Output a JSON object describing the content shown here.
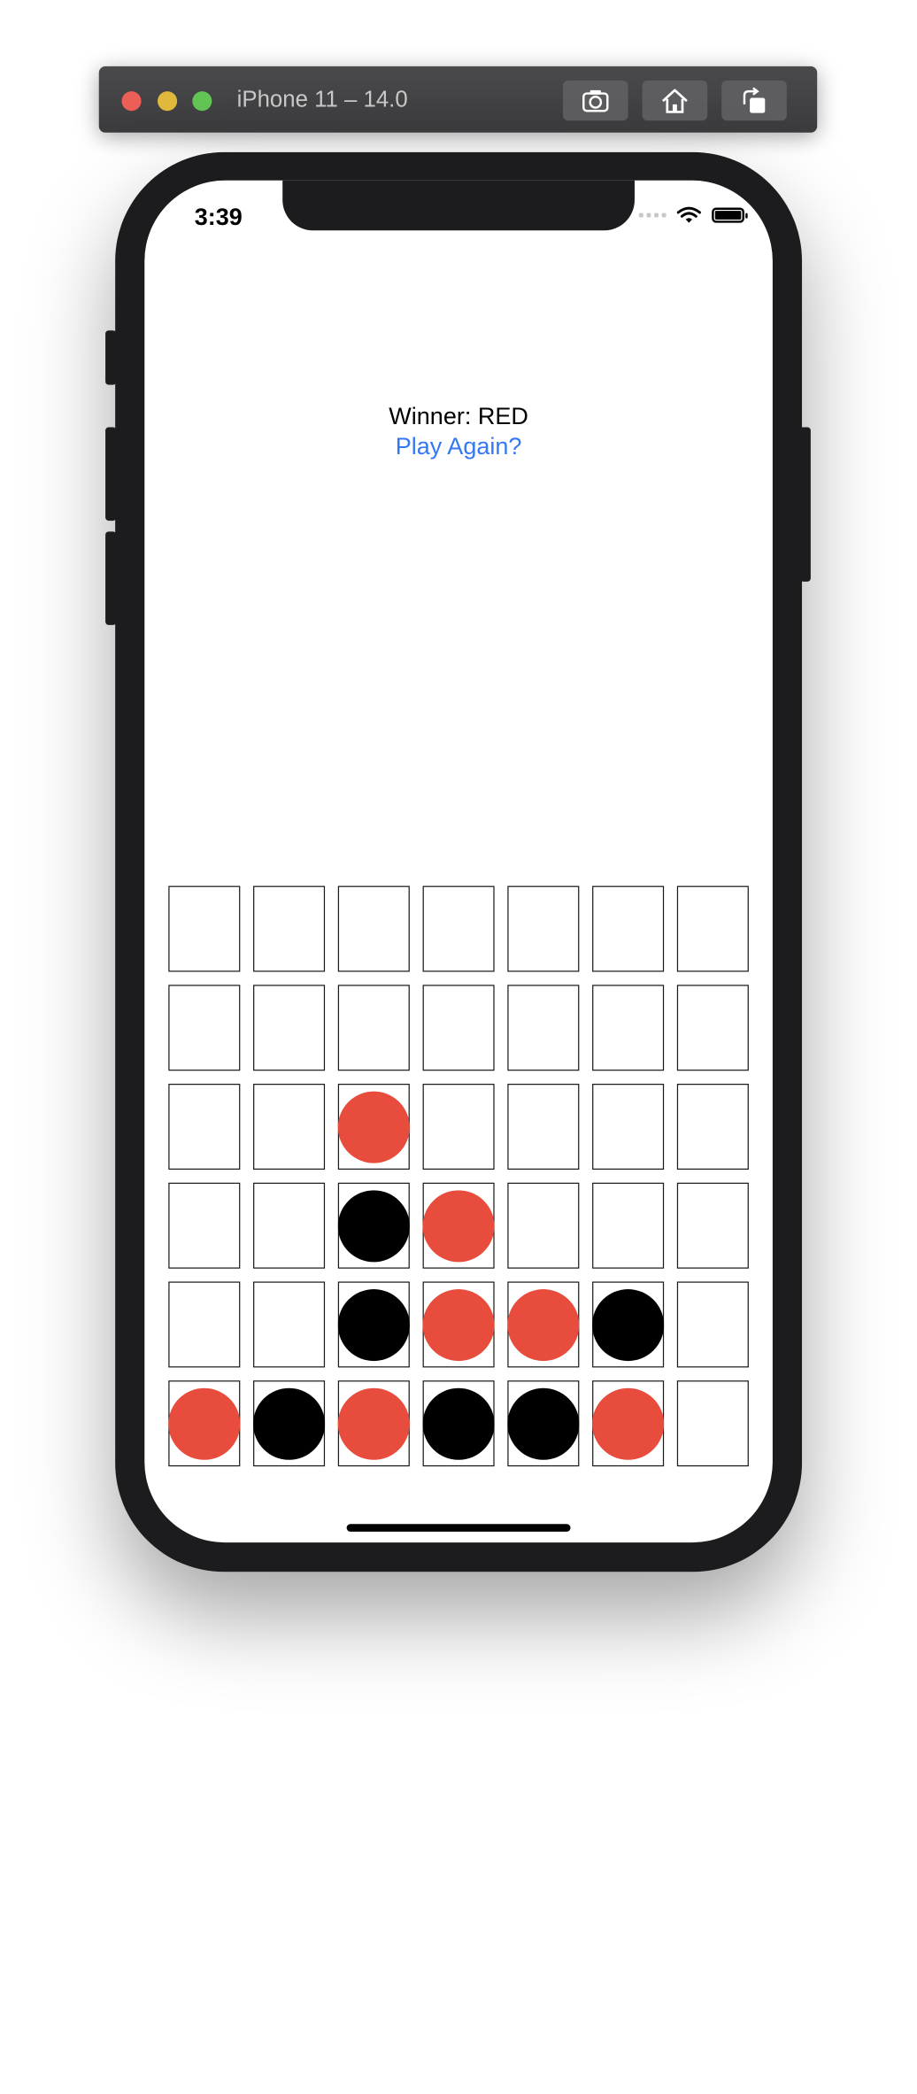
{
  "simulator": {
    "title": "iPhone 11 – 14.0",
    "buttons": [
      "screenshot-icon",
      "home-icon",
      "rotate-icon"
    ]
  },
  "status_bar": {
    "time": "3:39"
  },
  "game": {
    "winner_text": "Winner: RED",
    "play_again_label": "Play Again?",
    "colors": {
      "red": "#e84c3d",
      "black": "#000000",
      "link": "#3478f6"
    },
    "board": [
      [
        "",
        "",
        "",
        "",
        "",
        "",
        ""
      ],
      [
        "",
        "",
        "",
        "",
        "",
        "",
        ""
      ],
      [
        "",
        "",
        "red",
        "",
        "",
        "",
        ""
      ],
      [
        "",
        "",
        "black",
        "red",
        "",
        "",
        ""
      ],
      [
        "",
        "",
        "black",
        "red",
        "red",
        "black",
        ""
      ],
      [
        "red",
        "black",
        "red",
        "black",
        "black",
        "red",
        ""
      ]
    ]
  }
}
